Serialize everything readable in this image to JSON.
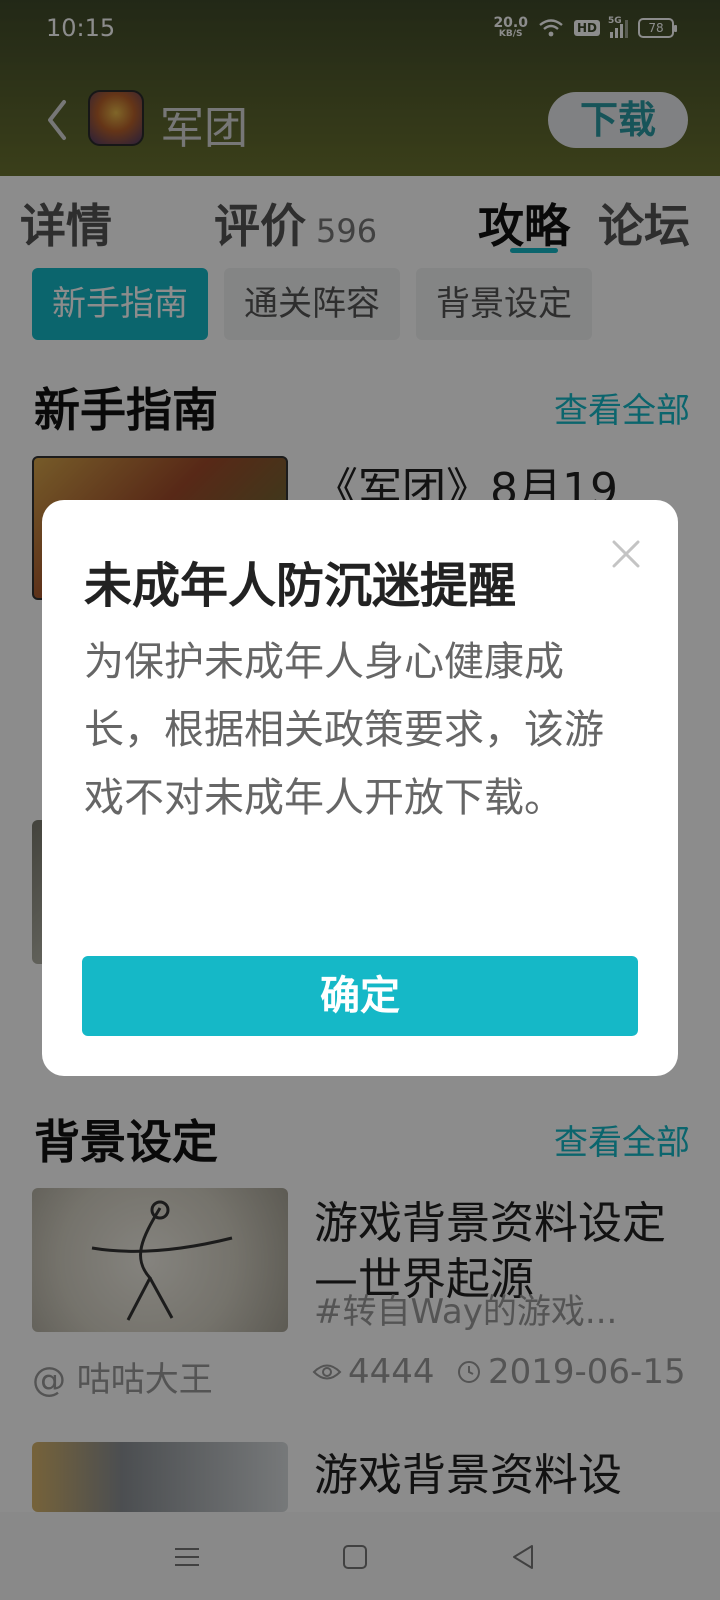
{
  "status_bar": {
    "time": "10:15",
    "net_speed_value": "20.0",
    "net_speed_unit": "KB/S",
    "hd_badge": "HD",
    "signal_label": "5G",
    "battery": "78"
  },
  "header": {
    "app_title": "军团",
    "download_label": "下载"
  },
  "tabs": [
    {
      "label": "详情"
    },
    {
      "label": "评价",
      "count": "596"
    },
    {
      "label": "攻略"
    },
    {
      "label": "论坛"
    }
  ],
  "chips": [
    "新手指南",
    "通关阵容",
    "背景设定"
  ],
  "sections": {
    "guide": {
      "title": "新手指南",
      "see_all": "查看全部",
      "card_title": "《军团》8月19"
    },
    "background": {
      "title": "背景设定",
      "see_all": "查看全部",
      "card1": {
        "title": "游戏背景资料设定—世界起源",
        "subtitle": "#转自Way的游戏...",
        "author": "@ 咕咕大王",
        "views": "4444",
        "date": "2019-06-15"
      },
      "card2": {
        "title": "游戏背景资料设"
      }
    }
  },
  "dialog": {
    "title": "未成年人防沉迷提醒",
    "body": "为保护未成年人身心健康成长，根据相关政策要求，该游戏不对未成年人开放下载。",
    "confirm_label": "确定"
  },
  "colors": {
    "accent": "#15b8c7",
    "overlay": "rgba(0,0,0,0.45)"
  }
}
